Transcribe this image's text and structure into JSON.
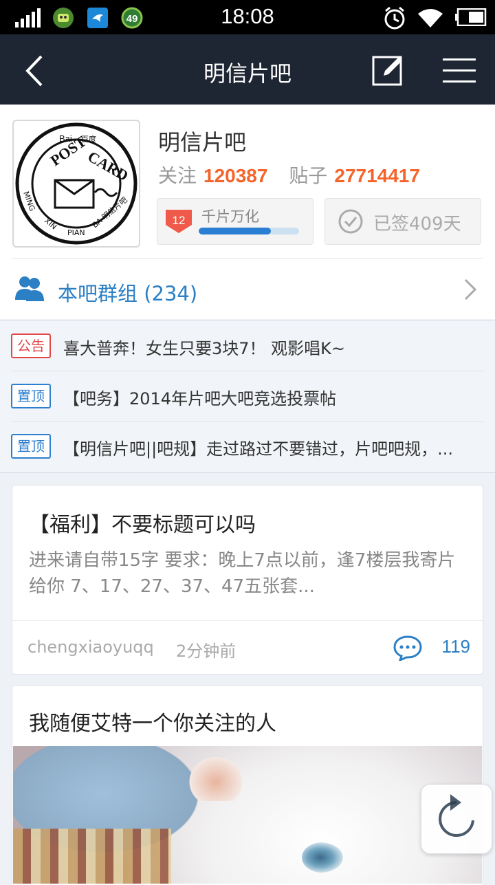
{
  "status_bar": {
    "time": "18:08",
    "badge_number": "49"
  },
  "nav": {
    "title": "明信片吧"
  },
  "forum": {
    "name": "明信片吧",
    "follow_label": "关注",
    "follow_count": "120387",
    "posts_label": "贴子",
    "posts_count": "27714417",
    "level_number": "12",
    "level_name": "千片万化",
    "level_progress": 0.72,
    "signed_text": "已签409天",
    "group_text": "本吧群组 (234)",
    "logo": {
      "top_text": "Bai",
      "top_text_cn": "百度",
      "arc_text": "POST CARD",
      "bottom_text": "MING XIN PIAN BA",
      "bottom_cn": "明信片吧"
    }
  },
  "notices": [
    {
      "tag": "公告",
      "tag_color": "red",
      "text": "喜大普奔！女生只要3块7！ 观影唱K~"
    },
    {
      "tag": "置顶",
      "tag_color": "blue",
      "text": "【吧务】2014年片吧大吧竞选投票帖"
    },
    {
      "tag": "置顶",
      "tag_color": "blue",
      "text": "【明信片吧||吧规】走过路过不要错过，片吧吧规，..."
    }
  ],
  "posts": [
    {
      "title": "【福利】不要标题可以吗",
      "body": "进来请自带15字 要求：晚上7点以前，逢7楼层我寄片给你 7、17、27、37、47五张套...",
      "author": "chengxiaoyuqq",
      "time": "2分钟前",
      "reply_count": "119"
    },
    {
      "title": "我随便艾特一个你关注的人"
    }
  ],
  "colors": {
    "nav_bg": "#1e2634",
    "accent_orange": "#f5642a",
    "link_blue": "#2b7fc4"
  }
}
